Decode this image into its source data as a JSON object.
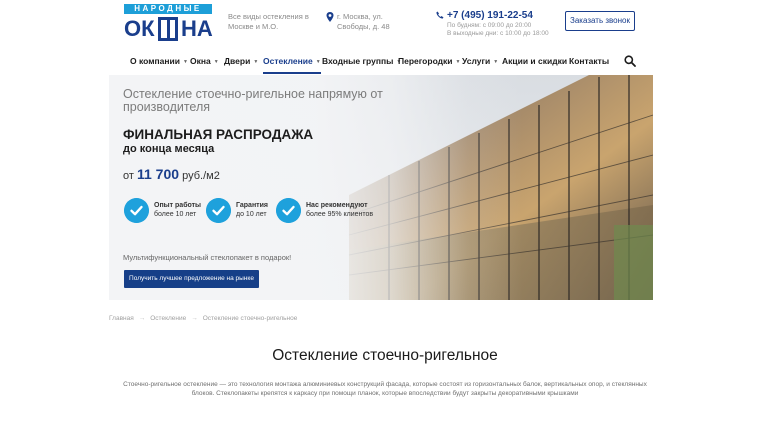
{
  "header": {
    "logo_top": "НАРОДНЫЕ",
    "logo_left": "ОК",
    "logo_right": "НА",
    "tagline": "Все виды остекления в Москве и М.О.",
    "address": "г. Москва, ул. Свободы, д. 48",
    "phone": "+7 (495) 191-22-54",
    "hours_line1": "По будням: с 09:00 до 20:00",
    "hours_line2": "В выходные дни: с 10:00 до 18:00",
    "callback_label": "Заказать звонок"
  },
  "nav": {
    "items": [
      {
        "label": "О компании",
        "dropdown": true
      },
      {
        "label": "Окна",
        "dropdown": true
      },
      {
        "label": "Двери",
        "dropdown": true
      },
      {
        "label": "Остекление",
        "dropdown": true,
        "active": true
      },
      {
        "label": "Входные группы",
        "dropdown": true
      },
      {
        "label": "Перегородки",
        "dropdown": true
      },
      {
        "label": "Услуги",
        "dropdown": true
      },
      {
        "label": "Акции и скидки",
        "dropdown": false
      },
      {
        "label": "Контакты",
        "dropdown": false
      }
    ],
    "search_icon": "search-icon"
  },
  "hero": {
    "subtitle": "Остекление стоечно-ригельное напрямую от производителя",
    "title": "ФИНАЛЬНАЯ РАСПРОДАЖА",
    "title2": "до конца месяца",
    "price_prefix": "от",
    "price_value": "11 700",
    "price_unit": "руб./м2",
    "features": [
      {
        "title": "Опыт работы",
        "text": "более 10 лет"
      },
      {
        "title": "Гарантия",
        "text": "до 10 лет"
      },
      {
        "title": "Нас рекомендуют",
        "text": "более 95% клиентов"
      }
    ],
    "gift": "Мультифункциональный стеклопакет в подарок!",
    "cta_label": "Получить лучшее предложение на рынке"
  },
  "breadcrumb": {
    "items": [
      "Главная",
      "Остекление",
      "Остекление стоечно-ригельное"
    ],
    "separator": "→"
  },
  "content": {
    "title": "Остекление стоечно-ригельное",
    "description": "Стоечно-ригельное остекление — это технология монтажа алюминиевых конструкций фасада, которые состоят из горизонтальных балок, вертикальных опор, и стеклянных блоков. Стеклопакеты крепятся к каркасу при помощи планок, которые впоследствии будут закрыты декоративными крышками"
  },
  "colors": {
    "brand": "#1a3e8c",
    "accent": "#1ea1dc",
    "button": "#163f88"
  }
}
